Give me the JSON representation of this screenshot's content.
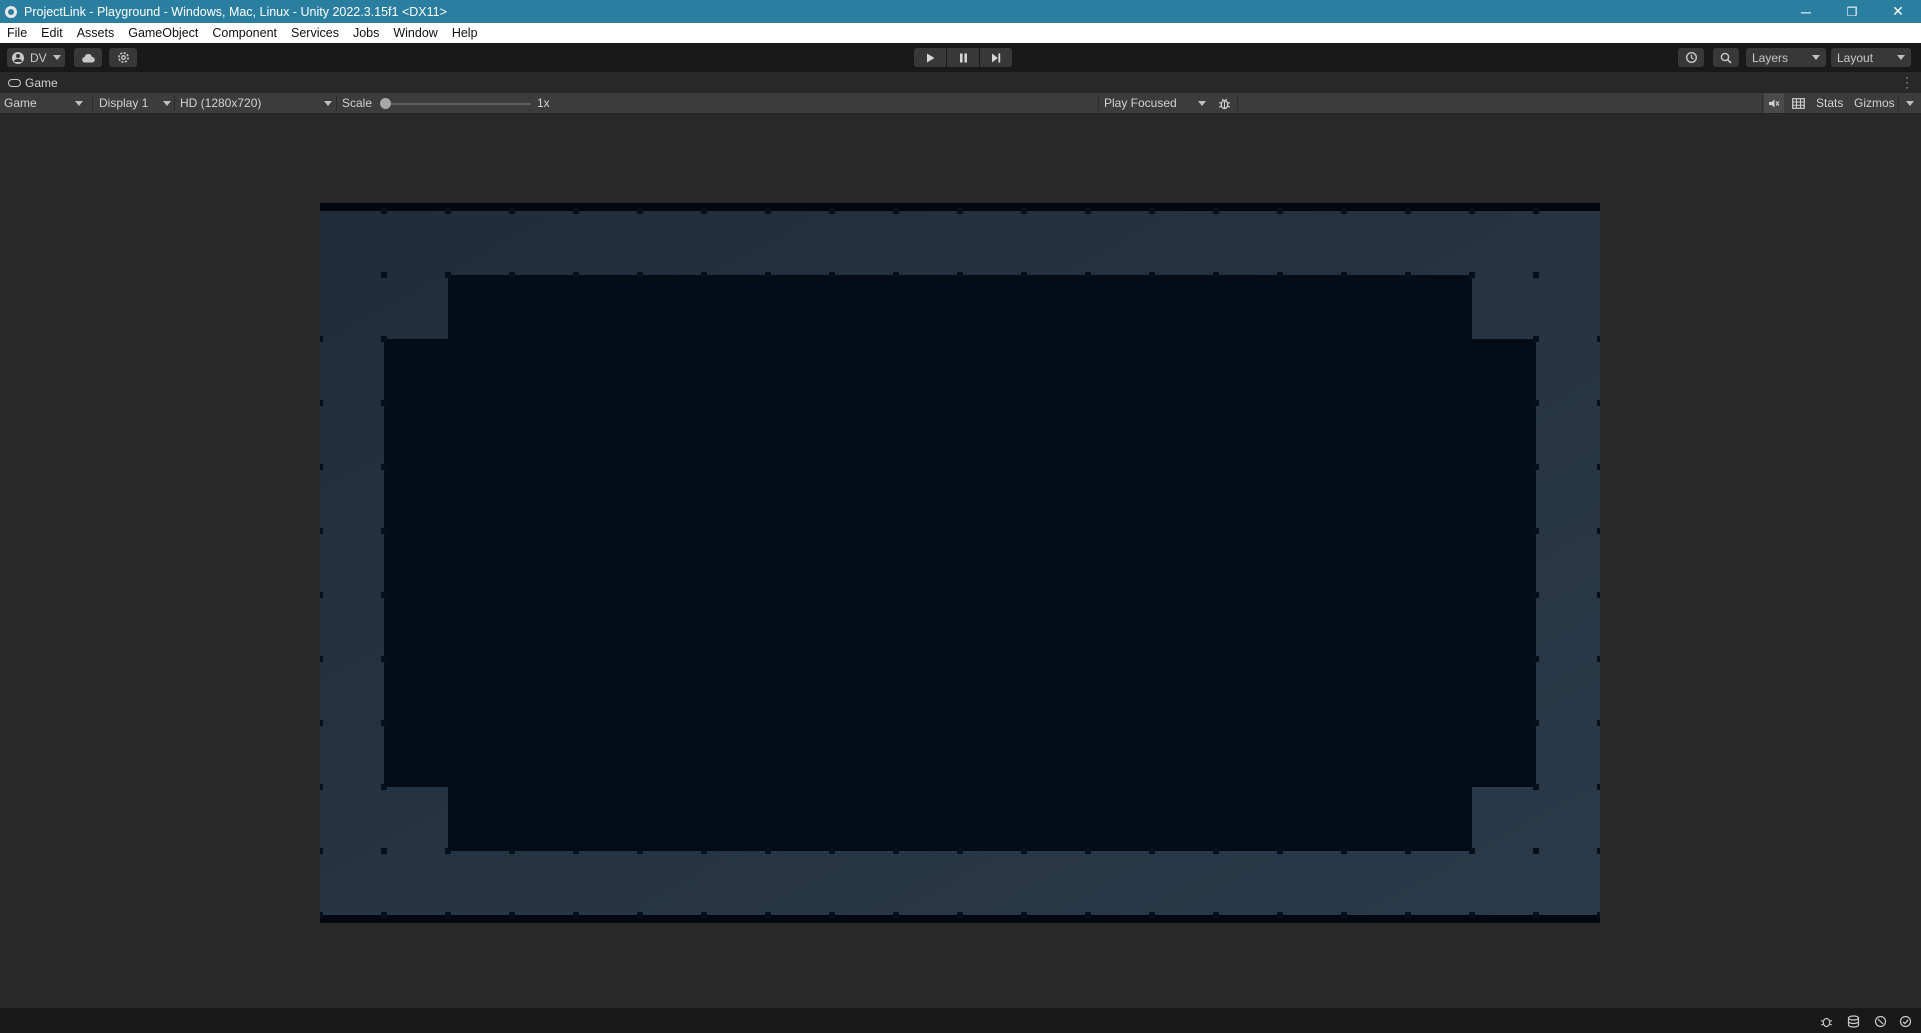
{
  "window": {
    "title": "ProjectLink - Playground - Windows, Mac, Linux - Unity 2022.3.15f1 <DX11>",
    "minimize_glyph": "─",
    "restore_glyph": "❐",
    "close_glyph": "✕"
  },
  "menu": {
    "items": [
      "File",
      "Edit",
      "Assets",
      "GameObject",
      "Component",
      "Services",
      "Jobs",
      "Window",
      "Help"
    ]
  },
  "toolbar": {
    "account_label": "DV",
    "layers_label": "Layers",
    "layout_label": "Layout"
  },
  "tab": {
    "title": "Game"
  },
  "game_view": {
    "view_mode": "Game",
    "display": "Display 1",
    "resolution": "HD (1280x720)",
    "scale_label": "Scale",
    "scale_value": "1x",
    "scale_fraction": 0.0,
    "play_mode": "Play Focused",
    "stats_label": "Stats",
    "gizmos_label": "Gizmos"
  },
  "colors": {
    "title_bar": "#2a7fa0",
    "editor_bg": "#282828",
    "toolbar_bg": "#191919",
    "game_border": "#243040",
    "game_inner": "#040c18",
    "game_edge": "#020710"
  },
  "icons": {
    "play": "play-icon",
    "pause": "pause-icon",
    "step": "step-icon",
    "cloud": "cloud-icon",
    "settings": "settings-icon",
    "history": "history-icon",
    "search": "search-icon",
    "bug": "bug-icon"
  }
}
